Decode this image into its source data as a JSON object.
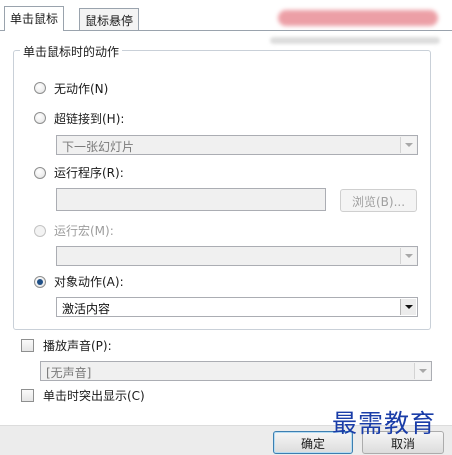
{
  "tabs": [
    {
      "label": "单击鼠标",
      "active": true
    },
    {
      "label": "鼠标悬停",
      "active": false
    }
  ],
  "group": {
    "legend": "单击鼠标时的动作",
    "options": {
      "none": {
        "label": "无动作(N)",
        "checked": false
      },
      "hyperlink": {
        "label": "超链接到(H):",
        "checked": false,
        "value": "下一张幻灯片"
      },
      "run_program": {
        "label": "运行程序(R):",
        "checked": false,
        "value": "",
        "browse_label": "浏览(B)..."
      },
      "run_macro": {
        "label": "运行宏(M):",
        "checked": false,
        "disabled": true,
        "value": ""
      },
      "object_action": {
        "label": "对象动作(A):",
        "checked": true,
        "value": "激活内容"
      }
    }
  },
  "play_sound": {
    "label": "播放声音(P):",
    "checked": false,
    "value": "[无声音]"
  },
  "highlight_click": {
    "label": "单击时突出显示(C)",
    "checked": false
  },
  "buttons": {
    "ok": "确定",
    "cancel": "取消"
  },
  "watermark": "最需教育"
}
